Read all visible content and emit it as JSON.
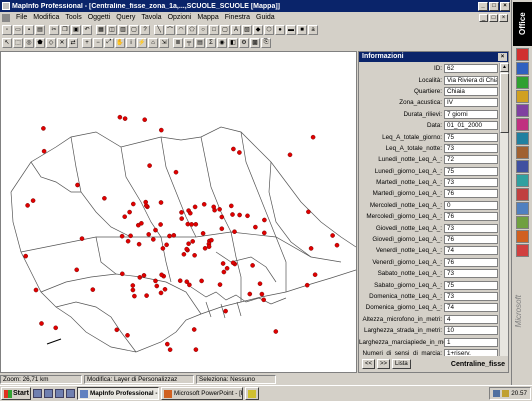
{
  "window": {
    "title": "MapInfo Professional - [Centraline_fisse_zona_1a,...,SCUOLE_SCUOLE [Mappa]]",
    "minimize": "_",
    "maximize": "□",
    "close": "×"
  },
  "menu": [
    "File",
    "Modifica",
    "Tools",
    "Oggetti",
    "Query",
    "Tavola",
    "Opzioni",
    "Mappa",
    "Finestra",
    "Guida"
  ],
  "info_panel": {
    "title": "Informazioni",
    "fields": [
      {
        "label": "ID:",
        "value": "62"
      },
      {
        "label": "Località:",
        "value": "Via Riviera di Chiaia"
      },
      {
        "label": "Quartiere:",
        "value": "Chiaia"
      },
      {
        "label": "Zona_acustica:",
        "value": "IV"
      },
      {
        "label": "Durata_rilievi:",
        "value": "7 giorni"
      },
      {
        "label": "Data:",
        "value": "01_01_2000"
      },
      {
        "label": "Leq_A_totale_giorno:",
        "value": "75"
      },
      {
        "label": "Leq_A_totale_notte:",
        "value": "73"
      },
      {
        "label": "Lunedì_notte_Leq_A_:",
        "value": "72"
      },
      {
        "label": "Lunedì_giorno_Leq_A_:",
        "value": "75"
      },
      {
        "label": "Martedì_notte_Leq_A_:",
        "value": "73"
      },
      {
        "label": "Martedì_giorno_Leq_A_:",
        "value": "76"
      },
      {
        "label": "Mercoledì_notte_Leq_A_:",
        "value": "0"
      },
      {
        "label": "Mercoledì_giorno_Leq_A_:",
        "value": "76"
      },
      {
        "label": "Giovedì_notte_Leq_A_:",
        "value": "73"
      },
      {
        "label": "Giovedì_giorno_Leq_A_:",
        "value": "76"
      },
      {
        "label": "Venerdì_notte_Leq_A_:",
        "value": "74"
      },
      {
        "label": "Venerdì_giorno_Leq_A_:",
        "value": "76"
      },
      {
        "label": "Sabato_notte_Leq_A_:",
        "value": "73"
      },
      {
        "label": "Sabato_giorno_Leq_A_:",
        "value": "75"
      },
      {
        "label": "Domenica_notte_Leq_A_:",
        "value": "73"
      },
      {
        "label": "Domenica_giorno_Leq_A_:",
        "value": "74"
      },
      {
        "label": "Altezza_microfono_in_metri:",
        "value": "4"
      },
      {
        "label": "Larghezza_strada_in_metri:",
        "value": "10"
      },
      {
        "label": "Larghezza_marciapiede_in_metri:",
        "value": "1"
      },
      {
        "label": "Numeri_di_sensi_di_marcia:",
        "value": "1+riserv."
      },
      {
        "label": "Tipo_di_manto_stradale:",
        "value": "cubetti"
      }
    ],
    "prev_label": "<<",
    "next_label": ">>",
    "list_label": "Lista",
    "table_name": "Centraline_fisse"
  },
  "office_bar": {
    "logo": "Office",
    "brand": "Microsoft",
    "button_colors": [
      "#d03030",
      "#3060c0",
      "#30a030",
      "#d0a020",
      "#8040a0",
      "#c03080",
      "#2080a0",
      "#a06030",
      "#4050a0",
      "#30a0a0",
      "#c04040",
      "#5080c0",
      "#70a040",
      "#d06020",
      "#d04040"
    ]
  },
  "status": {
    "zoom": "Zoom: 26,71 km",
    "modify": "Modifica: Layer di Personalizzaz",
    "select": "Seleziona: Nessuno"
  },
  "taskbar": {
    "start": "Start",
    "tasks": [
      "MapInfo Professional - ...",
      "Microsoft PowerPoint - [P...",
      ""
    ],
    "clock": "20.57"
  },
  "map": {
    "point_color": "#e00000",
    "sample_points": 120
  }
}
